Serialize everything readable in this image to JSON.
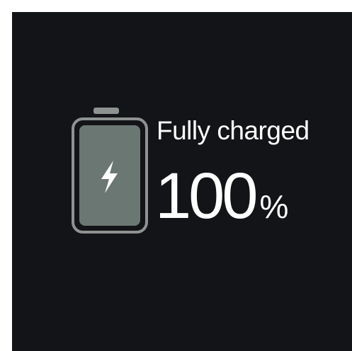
{
  "battery": {
    "status_label": "Fully charged",
    "level_value": "100",
    "level_unit": "%",
    "level_fraction": 1.0,
    "icon": "lightning-bolt-icon"
  },
  "colors": {
    "screen_background": "#131417",
    "battery_fill": "#6b7773",
    "battery_outline": "#8e9391",
    "text": "#ffffff"
  }
}
